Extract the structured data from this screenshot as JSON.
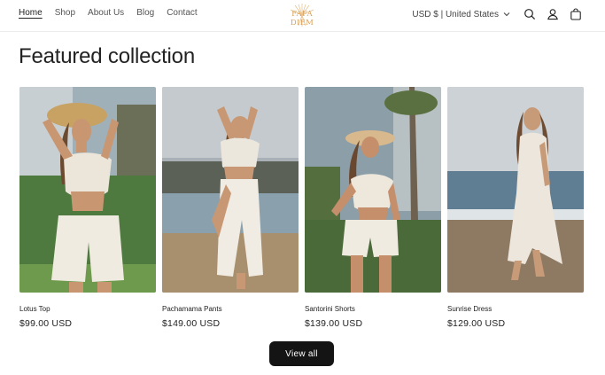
{
  "header": {
    "nav": [
      "Home",
      "Shop",
      "About Us",
      "Blog",
      "Contact"
    ],
    "logo_text": "FAFA DIEM",
    "currency": "USD $ | United States"
  },
  "section": {
    "title": "Featured collection"
  },
  "products": [
    {
      "title": "Lotus Top",
      "price": "$99.00 USD"
    },
    {
      "title": "Pachamama Pants",
      "price": "$149.00 USD"
    },
    {
      "title": "Santorini Shorts",
      "price": "$139.00 USD"
    },
    {
      "title": "Sunrise Dress",
      "price": "$129.00 USD"
    }
  ],
  "view_all": "View all",
  "colors": {
    "logo": "#d9a15a",
    "button": "#141414",
    "text": "#222222"
  },
  "icons": [
    "search-icon",
    "account-icon",
    "cart-icon",
    "chevron-down-icon",
    "sun-logo-icon"
  ]
}
